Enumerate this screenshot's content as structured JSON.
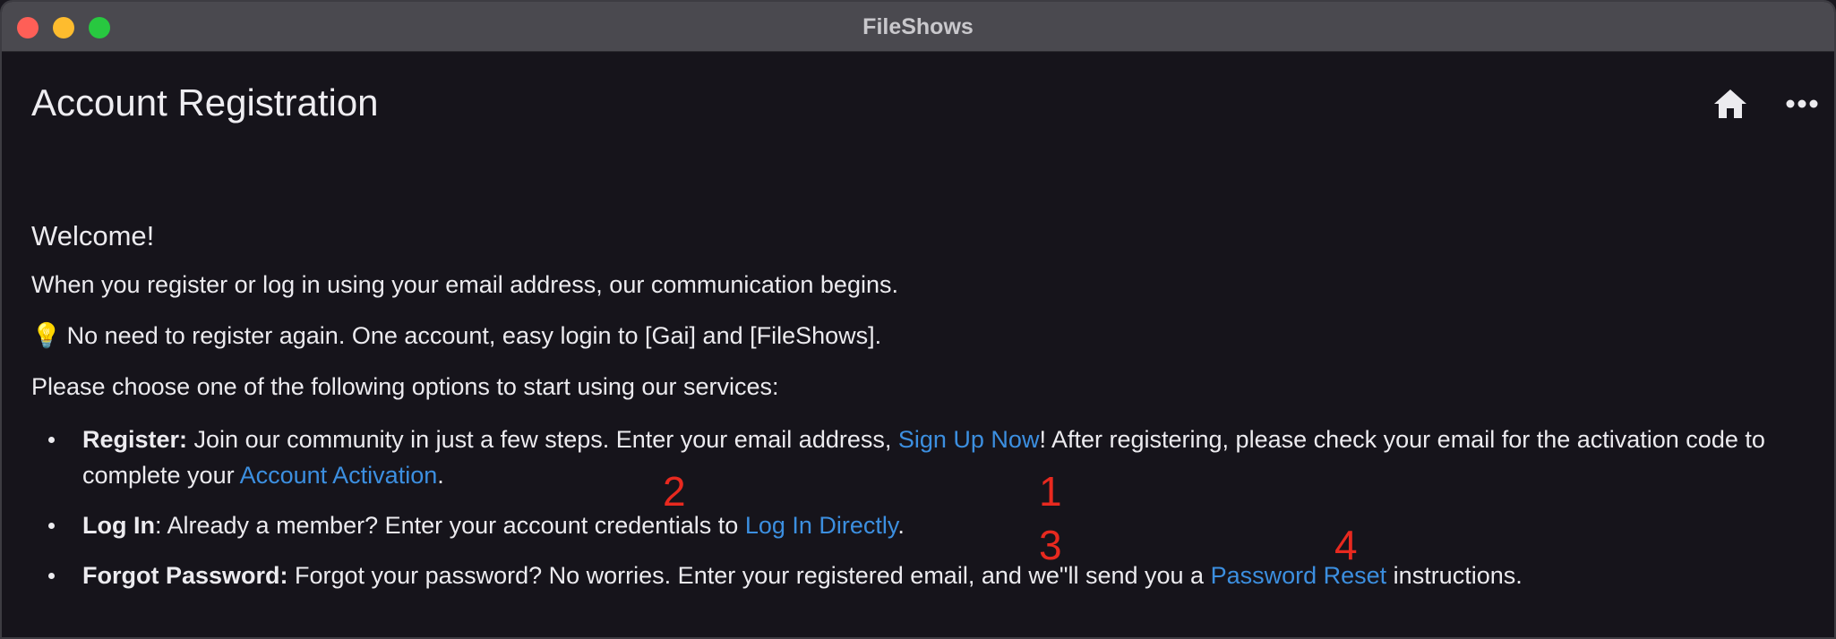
{
  "window": {
    "title": "FileShows"
  },
  "header": {
    "title": "Account Registration",
    "icons": {
      "home": "home-icon",
      "more": "more-horizontal-icon"
    }
  },
  "content": {
    "welcome": "Welcome!",
    "intro": "When you register or log in using your email address, our communication begins.",
    "tip": "No need to register again. One account, easy login to [Gai] and [FileShows].",
    "tip_icon": "💡",
    "choose": "Please choose one of the following options to start using our services:",
    "options": [
      {
        "label": "Register:",
        "text_before": " Join our community in just a few steps. Enter your email address, ",
        "link1": "Sign Up Now",
        "text_mid": "! After registering, please check your email for the activation code to complete your ",
        "link2": "Account Activation",
        "text_after": "."
      },
      {
        "label": "Log In",
        "text_before": ": Already a member? Enter your account credentials to ",
        "link1": "Log In Directly",
        "text_after": "."
      },
      {
        "label": "Forgot Password:",
        "text_before": " Forgot your password? No worries. Enter your registered email, and we\"ll send you a ",
        "link1": "Password Reset",
        "text_after": " instructions."
      }
    ]
  },
  "annotations": [
    "1",
    "2",
    "3",
    "4"
  ],
  "colors": {
    "link": "#3c8fe0",
    "annotation": "#e8291f",
    "background": "#16141b"
  }
}
